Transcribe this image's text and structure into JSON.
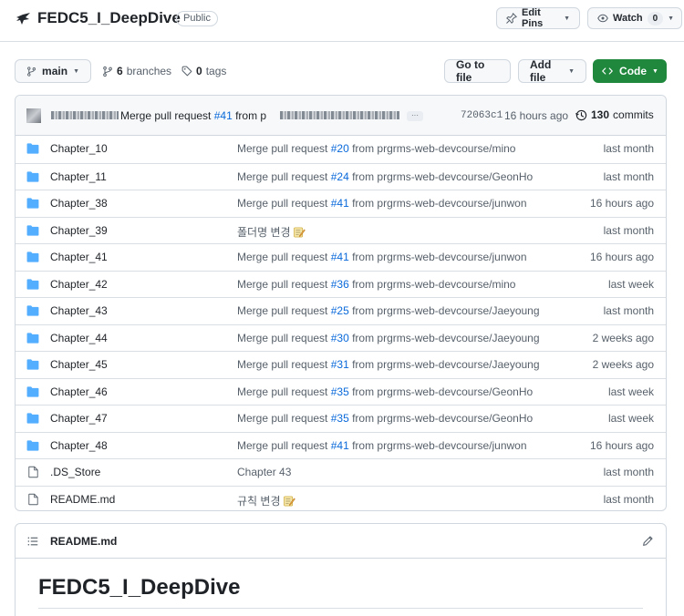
{
  "repo": {
    "name": "FEDC5_I_DeepDive",
    "visibility": "Public"
  },
  "actions": {
    "edit_pins": "Edit Pins",
    "watch": "Watch",
    "watch_count": "0"
  },
  "toolbar": {
    "branch": "main",
    "branches_count": "6",
    "branches_label": "branches",
    "tags_count": "0",
    "tags_label": "tags",
    "go_to_file": "Go to file",
    "add_file": "Add file",
    "code": "Code"
  },
  "latest_commit": {
    "message_prefix": "Merge pull request ",
    "pr": "#41",
    "message_suffix": " from p",
    "sha": "72063c1",
    "time": "16 hours ago",
    "commits_count": "130",
    "commits_label": "commits"
  },
  "files": [
    {
      "type": "folder",
      "name": "Chapter_10",
      "msg_prefix": "Merge pull request ",
      "pr": "#20",
      "msg_suffix": " from prgrms-web-devcourse/mino",
      "age": "last month"
    },
    {
      "type": "folder",
      "name": "Chapter_11",
      "msg_prefix": "Merge pull request ",
      "pr": "#24",
      "msg_suffix": " from prgrms-web-devcourse/GeonHo",
      "age": "last month"
    },
    {
      "type": "folder",
      "name": "Chapter_38",
      "msg_prefix": "Merge pull request ",
      "pr": "#41",
      "msg_suffix": " from prgrms-web-devcourse/junwon",
      "age": "16 hours ago"
    },
    {
      "type": "folder",
      "name": "Chapter_39",
      "msg_prefix": "폴더명 변경",
      "pr": "",
      "msg_suffix": "",
      "emoji": true,
      "age": "last month"
    },
    {
      "type": "folder",
      "name": "Chapter_41",
      "msg_prefix": "Merge pull request ",
      "pr": "#41",
      "msg_suffix": " from prgrms-web-devcourse/junwon",
      "age": "16 hours ago"
    },
    {
      "type": "folder",
      "name": "Chapter_42",
      "msg_prefix": "Merge pull request ",
      "pr": "#36",
      "msg_suffix": " from prgrms-web-devcourse/mino",
      "age": "last week"
    },
    {
      "type": "folder",
      "name": "Chapter_43",
      "msg_prefix": "Merge pull request ",
      "pr": "#25",
      "msg_suffix": " from prgrms-web-devcourse/Jaeyoung",
      "age": "last month"
    },
    {
      "type": "folder",
      "name": "Chapter_44",
      "msg_prefix": "Merge pull request ",
      "pr": "#30",
      "msg_suffix": " from prgrms-web-devcourse/Jaeyoung",
      "age": "2 weeks ago"
    },
    {
      "type": "folder",
      "name": "Chapter_45",
      "msg_prefix": "Merge pull request ",
      "pr": "#31",
      "msg_suffix": " from prgrms-web-devcourse/Jaeyoung",
      "age": "2 weeks ago"
    },
    {
      "type": "folder",
      "name": "Chapter_46",
      "msg_prefix": "Merge pull request ",
      "pr": "#35",
      "msg_suffix": " from prgrms-web-devcourse/GeonHo",
      "age": "last week"
    },
    {
      "type": "folder",
      "name": "Chapter_47",
      "msg_prefix": "Merge pull request ",
      "pr": "#35",
      "msg_suffix": " from prgrms-web-devcourse/GeonHo",
      "age": "last week"
    },
    {
      "type": "folder",
      "name": "Chapter_48",
      "msg_prefix": "Merge pull request ",
      "pr": "#41",
      "msg_suffix": " from prgrms-web-devcourse/junwon",
      "age": "16 hours ago"
    },
    {
      "type": "file",
      "name": ".DS_Store",
      "msg_prefix": "Chapter 43",
      "pr": "",
      "msg_suffix": "",
      "age": "last month"
    },
    {
      "type": "file",
      "name": "README.md",
      "msg_prefix": "규칙 변경",
      "pr": "",
      "msg_suffix": "",
      "emoji": true,
      "age": "last month"
    }
  ],
  "readme": {
    "filename": "README.md",
    "heading": "FEDC5_I_DeepDive"
  },
  "colors": {
    "accent_link": "#0969da",
    "code_button": "#1f883d",
    "folder_icon": "#54aeff"
  }
}
